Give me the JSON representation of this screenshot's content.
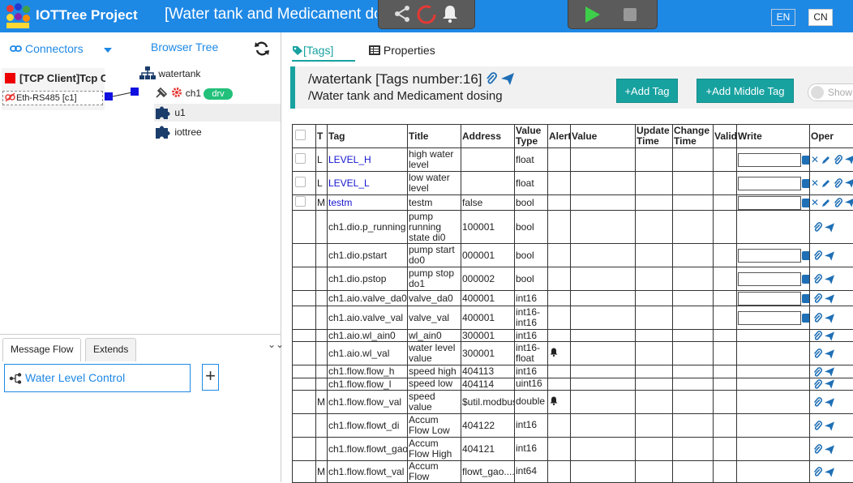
{
  "header": {
    "brand": "IOTTree Project",
    "title": "[Water tank and Medicament dosing]",
    "lang_en": "EN",
    "lang_cn": "CN",
    "toolbar_icons": [
      "share-icon",
      "running-spinner-icon",
      "bell-icon",
      "play-icon",
      "stop-icon"
    ],
    "colors": {
      "header_bg": "#1e88e5",
      "accent": "#17a2a0"
    }
  },
  "left": {
    "connectors_label": "Connectors",
    "browser_tree_label": "Browser Tree",
    "connector": {
      "name": "[TCP Client]Tcp Client",
      "sub": "Eth-RS485 [c1]"
    },
    "tree": {
      "root": "watertank",
      "ch1": "ch1",
      "ch1_badge": "drv",
      "u1": "u1",
      "iottree": "iottree"
    },
    "bottom_tabs": {
      "message_flow": "Message Flow",
      "extends": "Extends"
    },
    "flow_item": "Water Level Control",
    "add_label": "+"
  },
  "main": {
    "tabs": {
      "tags": "[Tags]",
      "properties": "Properties"
    },
    "path": "/watertank [Tags number:16]",
    "desc": "/Water tank and Medicament dosing",
    "add_tag": "+Add Tag",
    "add_middle_tag": "+Add Middle Tag",
    "show_label": "Show",
    "columns": [
      "T",
      "Tag",
      "Title",
      "Address",
      "Value Type",
      "Alert",
      "Value",
      "Update Time",
      "Change Time",
      "Valid",
      "Write",
      "Oper"
    ],
    "rows": [
      {
        "cb": true,
        "t": "L",
        "tag": "LEVEL_H",
        "link": true,
        "title": "high water level",
        "addr": "",
        "vt": "float",
        "alert": false,
        "write": true,
        "full_ops": true
      },
      {
        "cb": true,
        "t": "L",
        "tag": "LEVEL_L",
        "link": true,
        "title": "low water level",
        "addr": "",
        "vt": "float",
        "alert": false,
        "write": true,
        "full_ops": true
      },
      {
        "cb": true,
        "t": "M",
        "tag": "testm",
        "link": true,
        "title": "testm",
        "addr": "false",
        "vt": "bool",
        "alert": false,
        "write": true,
        "full_ops": true
      },
      {
        "cb": false,
        "t": "",
        "tag": "ch1.dio.p_running",
        "link": false,
        "title": "pump running state di0",
        "addr": "100001",
        "vt": "bool",
        "alert": false,
        "write": false,
        "full_ops": false
      },
      {
        "cb": false,
        "t": "",
        "tag": "ch1.dio.pstart",
        "link": false,
        "title": "pump start do0",
        "addr": "000001",
        "vt": "bool",
        "alert": false,
        "write": true,
        "full_ops": false
      },
      {
        "cb": false,
        "t": "",
        "tag": "ch1.dio.pstop",
        "link": false,
        "title": "pump stop do1",
        "addr": "000002",
        "vt": "bool",
        "alert": false,
        "write": true,
        "full_ops": false
      },
      {
        "cb": false,
        "t": "",
        "tag": "ch1.aio.valve_da0",
        "link": false,
        "title": "valve_da0",
        "addr": "400001",
        "vt": "int16",
        "alert": false,
        "write": true,
        "full_ops": false
      },
      {
        "cb": false,
        "t": "",
        "tag": "ch1.aio.valve_val",
        "link": false,
        "title": "valve_val",
        "addr": "400001",
        "vt": "int16-int16",
        "alert": false,
        "write": true,
        "full_ops": false
      },
      {
        "cb": false,
        "t": "",
        "tag": "ch1.aio.wl_ain0",
        "link": false,
        "title": "wl_ain0",
        "addr": "300001",
        "vt": "int16",
        "alert": false,
        "write": false,
        "full_ops": false
      },
      {
        "cb": false,
        "t": "",
        "tag": "ch1.aio.wl_val",
        "link": false,
        "title": "water level value",
        "addr": "300001",
        "vt": "int16-float",
        "alert": true,
        "write": false,
        "full_ops": false
      },
      {
        "cb": false,
        "t": "",
        "tag": "ch1.flow.flow_h",
        "link": false,
        "title": "speed high",
        "addr": "404113",
        "vt": "int16",
        "alert": false,
        "write": false,
        "full_ops": false
      },
      {
        "cb": false,
        "t": "",
        "tag": "ch1.flow.flow_l",
        "link": false,
        "title": "speed low",
        "addr": "404114",
        "vt": "uint16",
        "alert": false,
        "write": false,
        "full_ops": false
      },
      {
        "cb": false,
        "t": "M",
        "tag": "ch1.flow.flow_val",
        "link": false,
        "title": "speed value",
        "addr": "$util.modbus_",
        "vt": "double",
        "alert": true,
        "write": false,
        "full_ops": false
      },
      {
        "cb": false,
        "t": "",
        "tag": "ch1.flow.flowt_di",
        "link": false,
        "title": "Accum Flow Low",
        "addr": "404122",
        "vt": "int16",
        "alert": false,
        "write": false,
        "full_ops": false
      },
      {
        "cb": false,
        "t": "",
        "tag": "ch1.flow.flowt_gao",
        "link": false,
        "title": "Accum Flow High",
        "addr": "404121",
        "vt": "int16",
        "alert": false,
        "write": false,
        "full_ops": false
      },
      {
        "cb": false,
        "t": "M",
        "tag": "ch1.flow.flowt_val",
        "link": false,
        "title": "Accum Flow",
        "addr": "flowt_gao.....",
        "vt": "int64",
        "alert": false,
        "write": false,
        "full_ops": false
      }
    ]
  }
}
